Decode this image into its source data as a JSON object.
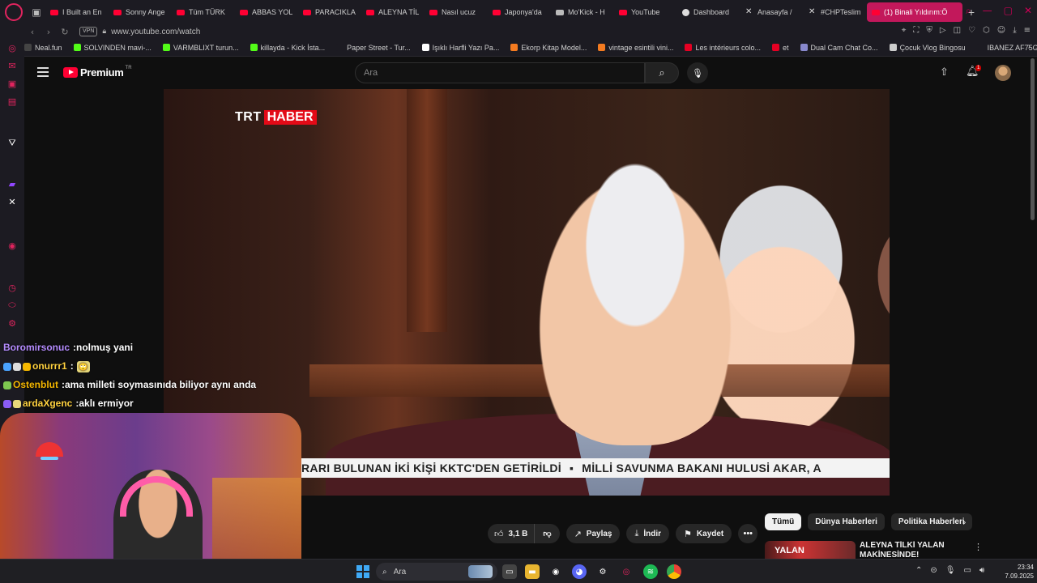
{
  "browser": {
    "tabs": [
      {
        "label": "I Built an En",
        "icon": "youtube-icon"
      },
      {
        "label": "Sonny Ange",
        "icon": "youtube-icon"
      },
      {
        "label": "Tüm TÜRK",
        "icon": "youtube-icon"
      },
      {
        "label": "ABBAS YOL",
        "icon": "youtube-icon"
      },
      {
        "label": "PARACIKLA",
        "icon": "youtube-icon"
      },
      {
        "label": "ALEYNA TİL",
        "icon": "youtube-icon"
      },
      {
        "label": "Nasıl ucuz",
        "icon": "youtube-icon"
      },
      {
        "label": "Japonya'da",
        "icon": "youtube-icon"
      },
      {
        "label": "Mo'Kick - H",
        "icon": "mokick-icon"
      },
      {
        "label": "YouTube",
        "icon": "youtube-icon"
      },
      {
        "label": "Dashboard",
        "icon": "dashboard-icon"
      },
      {
        "label": "Anasayfa /",
        "icon": "x-icon"
      },
      {
        "label": "#CHPTeslim",
        "icon": "x-icon"
      },
      {
        "label": "(1) Binali Yıldırım:Ö",
        "icon": "youtube-icon",
        "active": true
      }
    ],
    "url": "www.youtube.com/watch",
    "vpn_label": "VPN",
    "bookmarks": [
      {
        "label": "Neal.fun",
        "color": "#444444"
      },
      {
        "label": "SOLVINDEN mavi-...",
        "color": "#53fc18"
      },
      {
        "label": "VARMBLIXT turun...",
        "color": "#53fc18"
      },
      {
        "label": "killayda - Kick İsta...",
        "color": "#53fc18"
      },
      {
        "label": "Paper Street - Tur...",
        "color": "#1c1b22"
      },
      {
        "label": "Işıklı Harfli Yazı Pa...",
        "color": "#ffffff"
      },
      {
        "label": "Ekorp Kitap Model...",
        "color": "#f47b20"
      },
      {
        "label": "vintage esintili vini...",
        "color": "#f47b20"
      },
      {
        "label": "Les intérieurs colo...",
        "color": "#e60023"
      },
      {
        "label": "et",
        "color": "#e60023"
      },
      {
        "label": "Dual Cam Chat Co...",
        "color": "#8888cc"
      },
      {
        "label": "Çocuk Vlog Bingosu",
        "color": "#cccccc"
      },
      {
        "label": "IBANEZ AF75G-B...",
        "color": "#1c1b22"
      }
    ]
  },
  "youtube": {
    "brand": "Premium",
    "region": "TR",
    "search_placeholder": "Ara",
    "notification_count": "1"
  },
  "video": {
    "channel_logo_trt": "TRT",
    "channel_logo_haber": "HABER",
    "ticker_left": "RARI BULUNAN İKİ KİŞİ KKTC'DEN GETİRİLDİ",
    "ticker_right": "MİLLİ SAVUNMA BAKANI HULUSİ AKAR, A"
  },
  "actions": {
    "likes": "3,1 B",
    "share": "Paylaş",
    "download": "İndir",
    "save": "Kaydet"
  },
  "chips": [
    "Tümü",
    "Dünya Haberleri",
    "Politika Haberleri"
  ],
  "recommended": {
    "thumb_text": "YALAN",
    "title": "ALEYNA TİLKİ YALAN MAKİNESİNDE!"
  },
  "chat": [
    {
      "user": "Boromirsonuc",
      "color": "#b58cff",
      "message": "nolmuş yani"
    },
    {
      "user": "onurrr1",
      "color": "#ffd23f",
      "message": "",
      "badges": [
        "#4aa3ff",
        "#dddddd",
        "#f5b700"
      ],
      "emote": "🙄"
    },
    {
      "user": "Ostenblut",
      "color": "#f5b700",
      "message": "ama milleti soymasınıda biliyor aynı anda",
      "badges": [
        "#7ec850"
      ]
    },
    {
      "user": "ardaXgenc",
      "color": "#ffd23f",
      "message": "aklı ermiyor",
      "badges": [
        "#8a5cf6",
        "#e8d87a"
      ]
    }
  ],
  "taskbar": {
    "search_placeholder": "Ara",
    "time": "23:34",
    "date": "7.09.2025"
  }
}
